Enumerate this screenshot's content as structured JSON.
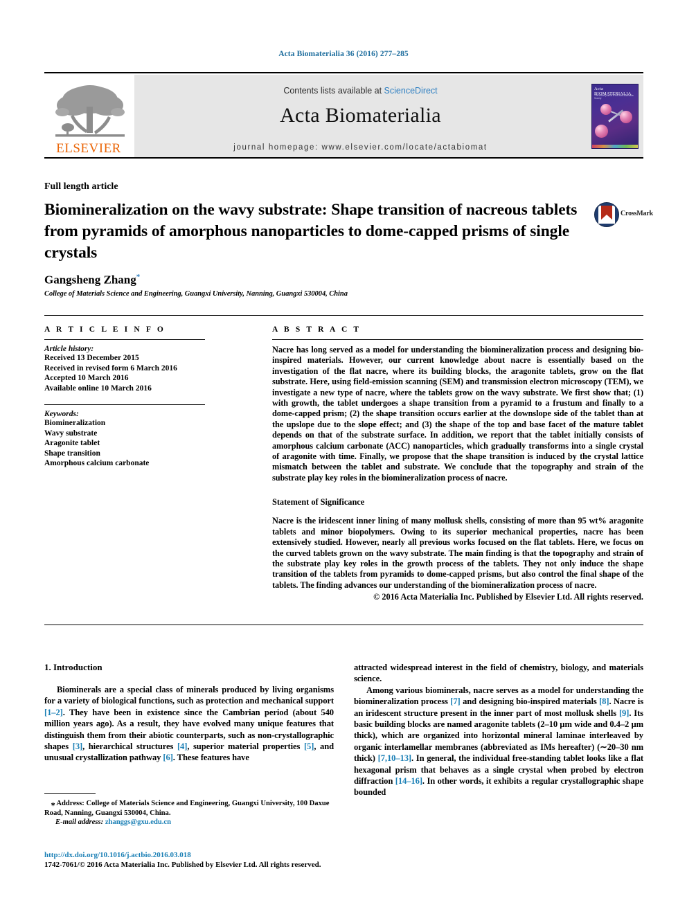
{
  "running_head": "Acta Biomaterialia 36 (2016) 277–285",
  "masthead": {
    "contents_prefix": "Contents lists available at ",
    "contents_link": "ScienceDirect",
    "journal_title": "Acta Biomaterialia",
    "homepage": "journal homepage: www.elsevier.com/locate/actabiomat",
    "publisher_logo_text": "ELSEVIER",
    "cover_title": "Acta BIOMATERIALIA",
    "cover_subtitle": "The official journal of the Acta Materialia Society"
  },
  "article": {
    "type": "Full length article",
    "title": "Biomineralization on the wavy substrate: Shape transition of nacreous tablets from pyramids of amorphous nanoparticles to dome-capped prisms of single crystals",
    "crossmark_label": "CrossMark",
    "author": "Gangsheng Zhang",
    "author_marker": "*",
    "affiliation": "College of Materials Science and Engineering, Guangxi University, Nanning, Guangxi 530004, China"
  },
  "article_info": {
    "heading": "A R T I C L E   I N F O",
    "history_label": "Article history:",
    "history": [
      "Received 13 December 2015",
      "Received in revised form 6 March 2016",
      "Accepted 10 March 2016",
      "Available online 10 March 2016"
    ],
    "keywords_label": "Keywords:",
    "keywords": [
      "Biomineralization",
      "Wavy substrate",
      "Aragonite tablet",
      "Shape transition",
      "Amorphous calcium carbonate"
    ]
  },
  "abstract": {
    "heading": "A B S T R A C T",
    "text": "Nacre has long served as a model for understanding the biomineralization process and designing bio-inspired materials. However, our current knowledge about nacre is essentially based on the investigation of the flat nacre, where its building blocks, the aragonite tablets, grow on the flat substrate. Here, using field-emission scanning (SEM) and transmission electron microscopy (TEM), we investigate a new type of nacre, where the tablets grow on the wavy substrate. We first show that; (1) with growth, the tablet undergoes a shape transition from a pyramid to a frustum and finally to a dome-capped prism; (2) the shape transition occurs earlier at the downslope side of the tablet than at the upslope due to the slope effect; and (3) the shape of the top and base facet of the mature tablet depends on that of the substrate surface. In addition, we report that the tablet initially consists of amorphous calcium carbonate (ACC) nanoparticles, which gradually transforms into a single crystal of aragonite with time. Finally, we propose that the shape transition is induced by the crystal lattice mismatch between the tablet and substrate. We conclude that the topography and strain of the substrate play key roles in the biomineralization process of nacre.",
    "significance_heading": "Statement of Significance",
    "significance_text": "Nacre is the iridescent inner lining of many mollusk shells, consisting of more than 95 wt% aragonite tablets and minor biopolymers. Owing to its superior mechanical properties, nacre has been extensively studied. However, nearly all previous works focused on the flat tablets. Here, we focus on the curved tablets grown on the wavy substrate. The main finding is that the topography and strain of the substrate play key roles in the growth process of the tablets. They not only induce the shape transition of the tablets from pyramids to dome-capped prisms, but also control the final shape of the tablets. The finding advances our understanding of the biomineralization process of nacre.",
    "copyright": "© 2016 Acta Materialia Inc. Published by Elsevier Ltd. All rights reserved."
  },
  "introduction": {
    "heading": "1. Introduction",
    "left_par1_a": "Biominerals are a special class of minerals produced by living organisms for a variety of biological functions, such as protection and mechanical support ",
    "left_ref1": "[1–2]",
    "left_par1_b": ". They have been in existence since the Cambrian period (about 540 million years ago). As a result, they have evolved many unique features that distinguish them from their abiotic counterparts, such as non-crystallographic shapes ",
    "left_ref2": "[3]",
    "left_par1_c": ", hierarchical structures ",
    "left_ref3": "[4]",
    "left_par1_d": ", superior material properties ",
    "left_ref4": "[5]",
    "left_par1_e": ", and unusual crystallization pathway ",
    "left_ref5": "[6]",
    "left_par1_f": ". These features have",
    "right_par0": "attracted widespread interest in the field of chemistry, biology, and materials science.",
    "right_par1_a": "Among various biominerals, nacre serves as a model for understanding the biomineralization process ",
    "right_ref1": "[7]",
    "right_par1_b": " and designing bio-inspired materials ",
    "right_ref2": "[8]",
    "right_par1_c": ". Nacre is an iridescent structure present in the inner part of most mollusk shells ",
    "right_ref3": "[9]",
    "right_par1_d": ". Its basic building blocks are named aragonite tablets (2–10 µm wide and 0.4–2 µm thick), which are organized into horizontal mineral laminae interleaved by organic interlamellar membranes (abbreviated as IMs hereafter) (∼20–30 nm thick) ",
    "right_ref4": "[7,10–13]",
    "right_par1_e": ". In general, the individual free-standing tablet looks like a flat hexagonal prism that behaves as a single crystal when probed by electron diffraction ",
    "right_ref5": "[14–16]",
    "right_par1_f": ". In other words, it exhibits a regular crystallographic shape bounded"
  },
  "footnote": {
    "marker": "⁎",
    "address": "Address: College of Materials Science and Engineering, Guangxi University, 100 Daxue Road, Nanning, Guangxi 530004, China.",
    "email_label": "E-mail address:",
    "email": "zhanggs@gxu.edu.cn"
  },
  "publication_footer": {
    "doi": "http://dx.doi.org/10.1016/j.actbio.2016.03.018",
    "issn_line": "1742-7061/© 2016 Acta Materialia Inc. Published by Elsevier Ltd. All rights reserved."
  },
  "colors": {
    "link": "#1a7fb5",
    "running_head": "#1a6b9c",
    "elsevier_orange": "#eb6608",
    "masthead_bg": "#e6e6e6"
  }
}
